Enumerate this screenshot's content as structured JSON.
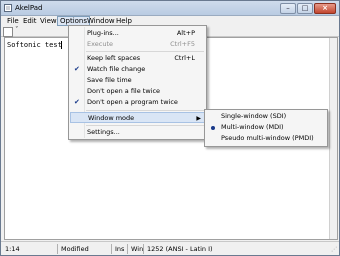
{
  "window": {
    "title": "AkelPad"
  },
  "menubar": {
    "items": [
      "File",
      "Edit",
      "View",
      "Options",
      "Window",
      "Help"
    ],
    "active": "Options"
  },
  "toolbar": {
    "tab_arrow": "ˇ"
  },
  "editor": {
    "text": "Softonic test"
  },
  "options_menu": {
    "items": [
      {
        "label": "Plug-ins...",
        "shortcut": "Alt+P",
        "disabled": false,
        "checked": false
      },
      {
        "label": "Execute",
        "shortcut": "Ctrl+F5",
        "disabled": true,
        "checked": false
      },
      {
        "label": "Keep left spaces",
        "shortcut": "Ctrl+L",
        "disabled": false,
        "checked": false
      },
      {
        "label": "Watch file change",
        "shortcut": "",
        "disabled": false,
        "checked": true
      },
      {
        "label": "Save file time",
        "shortcut": "",
        "disabled": false,
        "checked": false
      },
      {
        "label": "Don't open a file twice",
        "shortcut": "",
        "disabled": false,
        "checked": false
      },
      {
        "label": "Don't open a program twice",
        "shortcut": "",
        "disabled": false,
        "checked": true
      },
      {
        "label": "Window mode",
        "shortcut": "",
        "disabled": false,
        "checked": false,
        "submenu": true
      },
      {
        "label": "Settings...",
        "shortcut": "",
        "disabled": false,
        "checked": false
      }
    ]
  },
  "window_mode_submenu": {
    "items": [
      {
        "label": "Single-window (SDI)",
        "selected": false
      },
      {
        "label": "Multi-window (MDI)",
        "selected": true
      },
      {
        "label": "Pseudo multi-window (PMDI)",
        "selected": false
      }
    ]
  },
  "statusbar": {
    "position": "1:14",
    "modified": "Modified",
    "insert_mode": "Ins",
    "newline": "Win",
    "codepage": "1252  (ANSI - Latin I)"
  }
}
